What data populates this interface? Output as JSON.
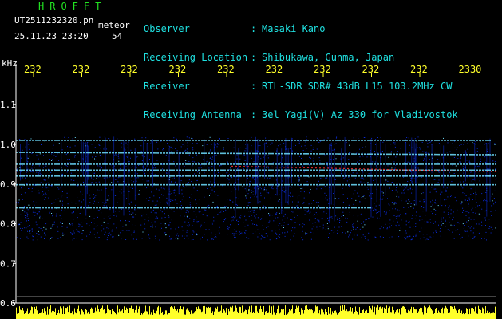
{
  "header": {
    "brand": "HROFFT",
    "filename": "UT2511232320.pn",
    "mode": "meteor",
    "datetime": "25.11.23 23:20",
    "count": "54",
    "fields": [
      {
        "label": "Observer",
        "value": "Masaki Kano"
      },
      {
        "label": "Receiving Location",
        "value": "Shibukawa, Gunma, Japan"
      },
      {
        "label": "Receiver",
        "value": "RTL-SDR SDR# 43dB L15 103.2MHz CW"
      },
      {
        "label": "Receiving Antenna",
        "value": "3el Yagi(V) Az 330 for Vladivostok"
      }
    ],
    "separator": ":"
  },
  "colors": {
    "background": "#000000",
    "brand": "#22e222",
    "header_label": "#1fe0e0",
    "white_text": "#ffffff",
    "time_ticks": "#ffff2a",
    "noise": "#0b2bd8",
    "signal": "#6fe0ff",
    "strong_signal": "#ff3030"
  },
  "chart_data": {
    "type": "heatmap",
    "ylabel": "kHz",
    "y_ticks": [
      "1.1",
      "1.0",
      "0.9",
      "0.8",
      "0.7",
      "0.6"
    ],
    "y_tick_values": [
      1.1,
      1.0,
      0.9,
      0.8,
      0.7,
      0.6
    ],
    "ylim": [
      0.6,
      1.15
    ],
    "x_ticks": [
      "232",
      "232",
      "232",
      "232",
      "232",
      "232",
      "232",
      "232",
      "232",
      "2330"
    ],
    "signal_band": [
      0.8,
      1.02
    ],
    "carrier_lines_khz": [
      1.01,
      0.98,
      0.95,
      0.935,
      0.92,
      0.898,
      0.84
    ],
    "strong_line_khz": 0.945
  }
}
